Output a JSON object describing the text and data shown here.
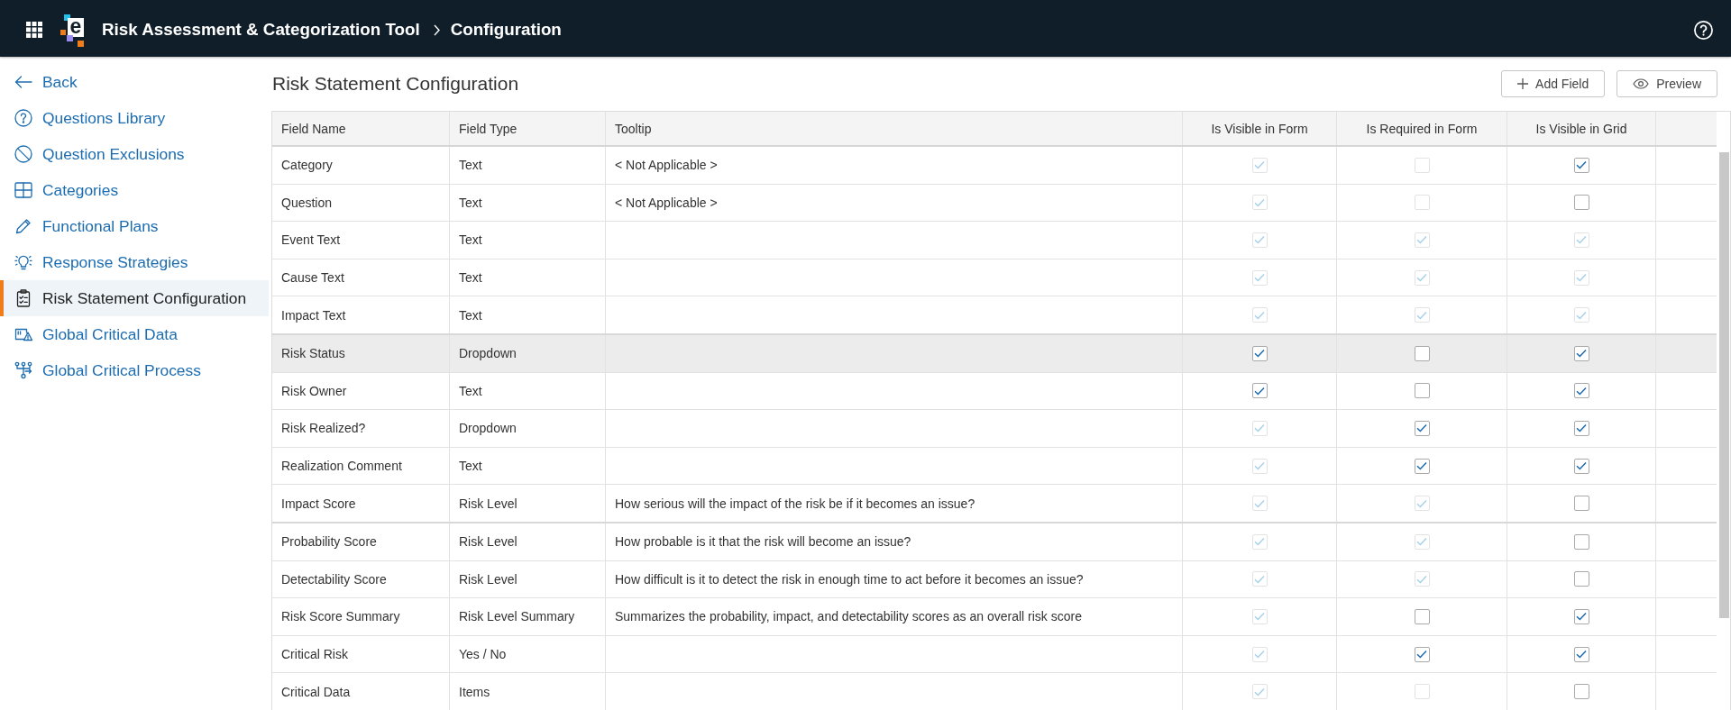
{
  "app_bar": {
    "logo_text": "e",
    "app_title": "Risk Assessment & Categorization Tool",
    "page_title": "Configuration"
  },
  "sidebar": {
    "back": "Back",
    "items": [
      {
        "label": "Questions Library",
        "selected": false
      },
      {
        "label": "Question Exclusions",
        "selected": false
      },
      {
        "label": "Categories",
        "selected": false
      },
      {
        "label": "Functional Plans",
        "selected": false
      },
      {
        "label": "Response Strategies",
        "selected": false
      },
      {
        "label": "Risk Statement Configuration",
        "selected": true
      },
      {
        "label": "Global Critical Data",
        "selected": false
      },
      {
        "label": "Global Critical Process",
        "selected": false
      }
    ]
  },
  "page": {
    "title": "Risk Statement Configuration",
    "buttons": [
      "Add Field",
      "Preview"
    ]
  },
  "table": {
    "columns": [
      {
        "label": "Field Name",
        "kind": "text"
      },
      {
        "label": "Field Type",
        "kind": "text"
      },
      {
        "label": "Tooltip",
        "kind": "text"
      },
      {
        "label": "Is Visible in Form",
        "kind": "checkbox"
      },
      {
        "label": "Is Required in Form",
        "kind": "checkbox"
      },
      {
        "label": "Is Visible in Grid",
        "kind": "checkbox"
      }
    ],
    "groups": [
      {
        "rows": [
          {
            "highlighted": false,
            "cells": [
              {
                "text": "Category"
              },
              {
                "text": "Text"
              },
              {
                "text": "< Not Applicable >"
              },
              {
                "checked": true,
                "disabled": true
              },
              {
                "checked": false,
                "disabled": true
              },
              {
                "checked": true,
                "disabled": false
              }
            ]
          },
          {
            "highlighted": false,
            "cells": [
              {
                "text": "Question"
              },
              {
                "text": "Text"
              },
              {
                "text": "< Not Applicable >"
              },
              {
                "checked": true,
                "disabled": true
              },
              {
                "checked": false,
                "disabled": true
              },
              {
                "checked": false,
                "disabled": false
              }
            ]
          },
          {
            "highlighted": false,
            "cells": [
              {
                "text": "Event Text"
              },
              {
                "text": "Text"
              },
              {},
              {
                "checked": true,
                "disabled": true
              },
              {
                "checked": true,
                "disabled": true
              },
              {
                "checked": true,
                "disabled": true
              }
            ]
          },
          {
            "highlighted": false,
            "cells": [
              {
                "text": "Cause Text"
              },
              {
                "text": "Text"
              },
              {},
              {
                "checked": true,
                "disabled": true
              },
              {
                "checked": true,
                "disabled": true
              },
              {
                "checked": true,
                "disabled": true
              }
            ]
          },
          {
            "highlighted": false,
            "cells": [
              {
                "text": "Impact Text"
              },
              {
                "text": "Text"
              },
              {},
              {
                "checked": true,
                "disabled": true
              },
              {
                "checked": true,
                "disabled": true
              },
              {
                "checked": true,
                "disabled": true
              }
            ]
          }
        ]
      },
      {
        "rows": [
          {
            "highlighted": true,
            "cells": [
              {
                "text": "Risk Status"
              },
              {
                "text": "Dropdown"
              },
              {},
              {
                "checked": true,
                "disabled": false
              },
              {
                "checked": false,
                "disabled": false
              },
              {
                "checked": true,
                "disabled": false
              }
            ]
          },
          {
            "highlighted": false,
            "cells": [
              {
                "text": "Risk Owner"
              },
              {
                "text": "Text"
              },
              {},
              {
                "checked": true,
                "disabled": false
              },
              {
                "checked": false,
                "disabled": false
              },
              {
                "checked": true,
                "disabled": false
              }
            ]
          },
          {
            "highlighted": false,
            "cells": [
              {
                "text": "Risk Realized?"
              },
              {
                "text": "Dropdown"
              },
              {},
              {
                "checked": true,
                "disabled": true
              },
              {
                "checked": true,
                "disabled": false
              },
              {
                "checked": true,
                "disabled": false
              }
            ]
          },
          {
            "highlighted": false,
            "cells": [
              {
                "text": "Realization Comment"
              },
              {
                "text": "Text"
              },
              {},
              {
                "checked": true,
                "disabled": true
              },
              {
                "checked": true,
                "disabled": false
              },
              {
                "checked": true,
                "disabled": false
              }
            ]
          },
          {
            "highlighted": false,
            "cells": [
              {
                "text": "Impact Score"
              },
              {
                "text": "Risk Level"
              },
              {
                "text": "How serious will the impact of the risk be if it becomes an issue?"
              },
              {
                "checked": true,
                "disabled": true
              },
              {
                "checked": true,
                "disabled": true
              },
              {
                "checked": false,
                "disabled": false
              }
            ]
          }
        ]
      },
      {
        "rows": [
          {
            "highlighted": false,
            "cells": [
              {
                "text": "Probability Score"
              },
              {
                "text": "Risk Level"
              },
              {
                "text": "How probable is it that the risk will become an issue?"
              },
              {
                "checked": true,
                "disabled": true
              },
              {
                "checked": true,
                "disabled": true
              },
              {
                "checked": false,
                "disabled": false
              }
            ]
          },
          {
            "highlighted": false,
            "cells": [
              {
                "text": "Detectability Score"
              },
              {
                "text": "Risk Level"
              },
              {
                "text": "How difficult is it to detect the risk in enough time to act before it becomes an issue?"
              },
              {
                "checked": true,
                "disabled": true
              },
              {
                "checked": true,
                "disabled": true
              },
              {
                "checked": false,
                "disabled": false
              }
            ]
          },
          {
            "highlighted": false,
            "cells": [
              {
                "text": "Risk Score Summary"
              },
              {
                "text": "Risk Level Summary"
              },
              {
                "text": "Summarizes the probability, impact, and detectability scores as an overall risk score"
              },
              {
                "checked": true,
                "disabled": true
              },
              {
                "checked": false,
                "disabled": false
              },
              {
                "checked": true,
                "disabled": false
              }
            ]
          },
          {
            "highlighted": false,
            "cells": [
              {
                "text": "Critical Risk"
              },
              {
                "text": "Yes / No"
              },
              {},
              {
                "checked": true,
                "disabled": true
              },
              {
                "checked": true,
                "disabled": false
              },
              {
                "checked": true,
                "disabled": false
              }
            ]
          },
          {
            "highlighted": false,
            "cells": [
              {
                "text": "Critical Data"
              },
              {
                "text": "Items"
              },
              {},
              {
                "checked": true,
                "disabled": true
              },
              {
                "checked": false,
                "disabled": true
              },
              {
                "checked": false,
                "disabled": false
              }
            ]
          }
        ]
      }
    ]
  }
}
